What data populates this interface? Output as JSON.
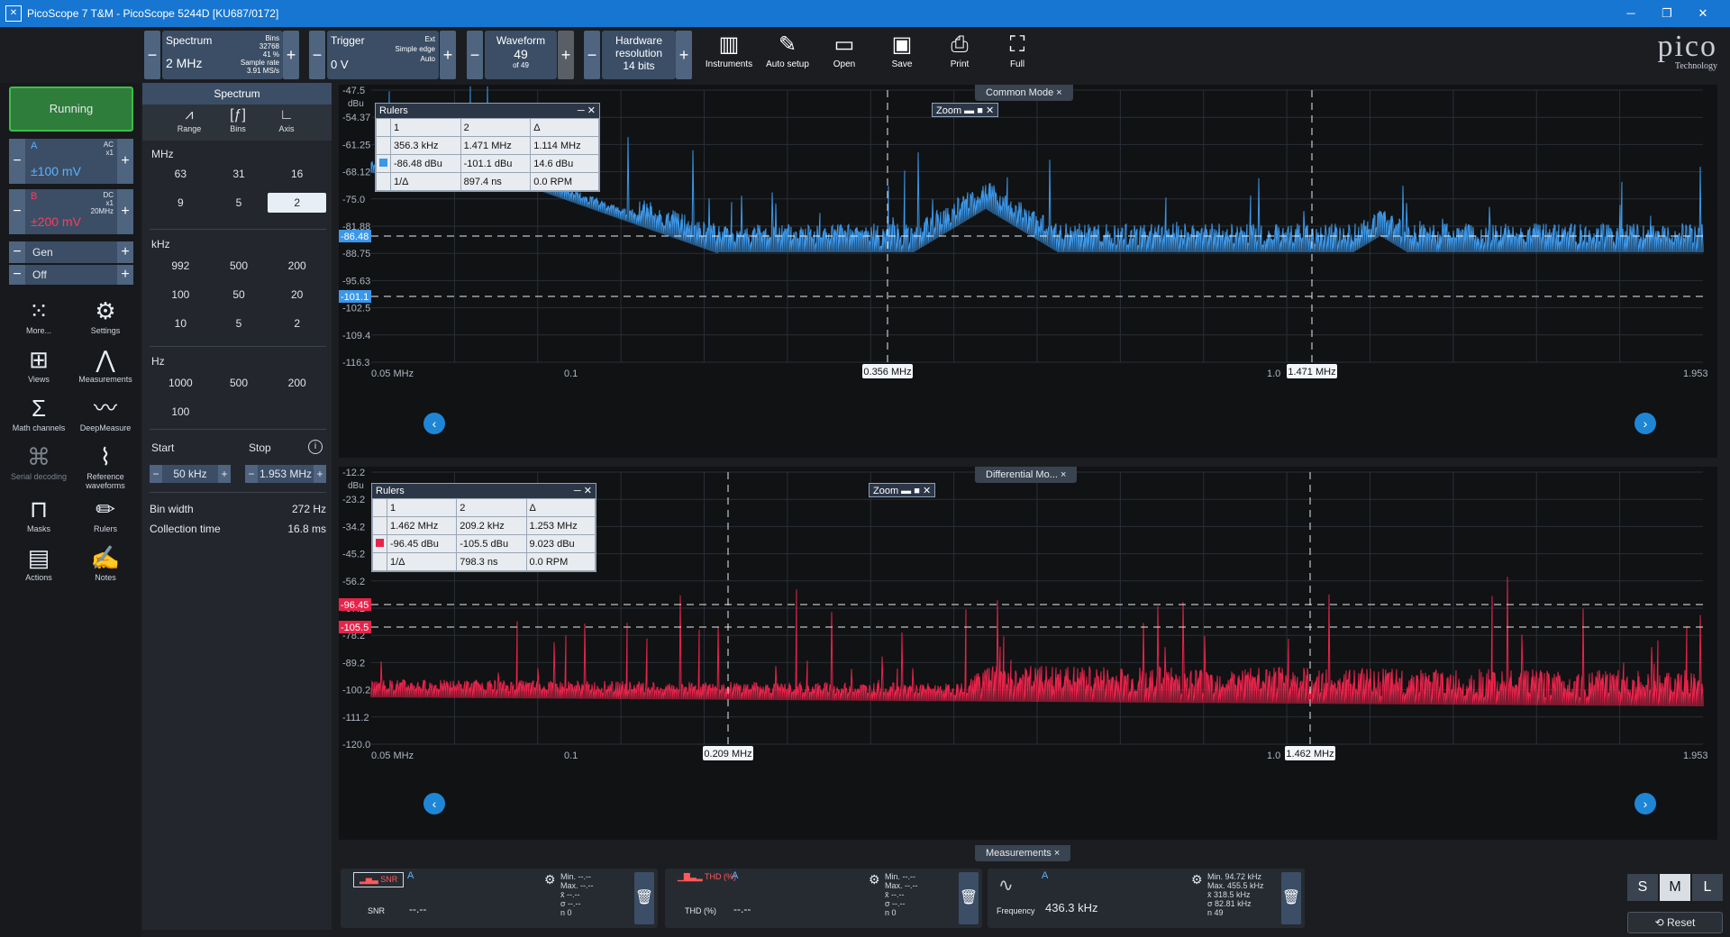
{
  "window": {
    "title": "PicoScope 7 T&M - PicoScope 5244D [KU687/0172]"
  },
  "toolbar": {
    "mode": {
      "label": "Spectrum",
      "value": "2 MHz",
      "bins_label": "Bins",
      "bins": "32768",
      "pct": "41 %",
      "rate_label": "Sample rate",
      "rate": "3.91 MS/s"
    },
    "trigger": {
      "label": "Trigger",
      "value": "0 V",
      "ext": "Ext",
      "type": "Simple edge",
      "mode": "Auto"
    },
    "waveform": {
      "label": "Waveform",
      "value": "49",
      "of": "of 49"
    },
    "hardware": {
      "label": "Hardware resolution",
      "value": "14 bits"
    },
    "buttons": [
      "Instruments",
      "Auto setup",
      "Open",
      "Save",
      "Print",
      "Full"
    ]
  },
  "logo": {
    "text": "pico",
    "sub": "Technology"
  },
  "left": {
    "run": "Running",
    "chA": {
      "name": "A",
      "coupling": "AC",
      "probe": "x1",
      "range": "±100 mV"
    },
    "chB": {
      "name": "B",
      "coupling": "DC",
      "probe": "x1",
      "bw": "20MHz",
      "range": "±200 mV"
    },
    "gen": "Gen",
    "off": "Off",
    "tools": [
      "More...",
      "Settings",
      "Views",
      "Measurements",
      "Math channels",
      "DeepMeasure",
      "Serial decoding",
      "Reference waveforms",
      "Masks",
      "Rulers",
      "Actions",
      "Notes"
    ]
  },
  "settings": {
    "title": "Spectrum",
    "tabs": [
      "Range",
      "Bins",
      "Axis"
    ],
    "mhz_label": "MHz",
    "mhz": [
      "63",
      "31",
      "16",
      "9",
      "5",
      "2"
    ],
    "mhz_selected": "2",
    "khz_label": "kHz",
    "khz": [
      "992",
      "500",
      "200",
      "100",
      "50",
      "20",
      "10",
      "5",
      "2"
    ],
    "hz_label": "Hz",
    "hz": [
      "1000",
      "500",
      "200",
      "100"
    ],
    "start_label": "Start",
    "stop_label": "Stop",
    "start": "50 kHz",
    "stop": "1.953 MHz",
    "binwidth_label": "Bin width",
    "binwidth": "272 Hz",
    "coll_label": "Collection time",
    "coll": "16.8 ms"
  },
  "views": [
    {
      "tab": "Common Mode",
      "unit": "dBu",
      "yticks": [
        "-47.5",
        "-54.37",
        "-61.25",
        "-68.12",
        "-75.0",
        "-81.88",
        "-88.75",
        "-95.63",
        "-102.5",
        "-109.4",
        "-116.3"
      ],
      "xticks": [
        "0.05 MHz",
        "0.1",
        "1.0",
        "1.953"
      ],
      "ruler_x": [
        "0.356 MHz",
        "1.471 MHz"
      ],
      "ruler_y": [
        "-86.48",
        "-101.1"
      ],
      "color": "#3c97e8",
      "rulers": {
        "title": "Rulers",
        "h": [
          "1",
          "2",
          "Δ"
        ],
        "r1": [
          "356.3 kHz",
          "1.471 MHz",
          "1.114 MHz"
        ],
        "r2": [
          "-86.48 dBu",
          "-101.1 dBu",
          "14.6 dBu"
        ],
        "r3": [
          "1/Δ",
          "897.4 ns",
          "0.0 RPM"
        ]
      },
      "zoom": "Zoom"
    },
    {
      "tab": "Differential Mo...",
      "unit": "dBu",
      "yticks": [
        "-12.2",
        "-23.2",
        "-34.2",
        "-45.2",
        "-56.2",
        "-67.2",
        "-78.2",
        "-89.2",
        "-100.2",
        "-111.2",
        "-120.0"
      ],
      "xticks": [
        "0.05 MHz",
        "0.1",
        "1.0",
        "1.953"
      ],
      "ruler_x": [
        "0.209 MHz",
        "1.462 MHz"
      ],
      "ruler_y": [
        "-96.45",
        "-105.5"
      ],
      "color": "#e8234a",
      "rulers": {
        "title": "Rulers",
        "h": [
          "1",
          "2",
          "Δ"
        ],
        "r1": [
          "1.462 MHz",
          "209.2 kHz",
          "1.253 MHz"
        ],
        "r2": [
          "-96.45 dBu",
          "-105.5 dBu",
          "9.023 dBu"
        ],
        "r3": [
          "1/Δ",
          "798.3 ns",
          "0.0 RPM"
        ]
      },
      "zoom": "Zoom"
    }
  ],
  "measurements": {
    "tab": "Measurements",
    "cards": [
      {
        "name": "SNR",
        "ch": "A",
        "value": "--.--",
        "stats": [
          "Min. --.--",
          "Max. --.--",
          "x̄ --.--",
          "σ --.--",
          "n 0"
        ]
      },
      {
        "name": "THD (%)",
        "ch": "A",
        "value": "--.--",
        "stats": [
          "Min. --.--",
          "Max. --.--",
          "x̄ --.--",
          "σ --.--",
          "n 0"
        ]
      },
      {
        "name": "Frequency",
        "ch": "A",
        "value": "436.3 kHz",
        "stats": [
          "Min. 94.72 kHz",
          "Max. 455.5 kHz",
          "x̄ 318.5 kHz",
          "σ 82.81 kHz",
          "n 49"
        ]
      }
    ],
    "sizes": [
      "S",
      "M",
      "L"
    ],
    "reset": "Reset"
  }
}
